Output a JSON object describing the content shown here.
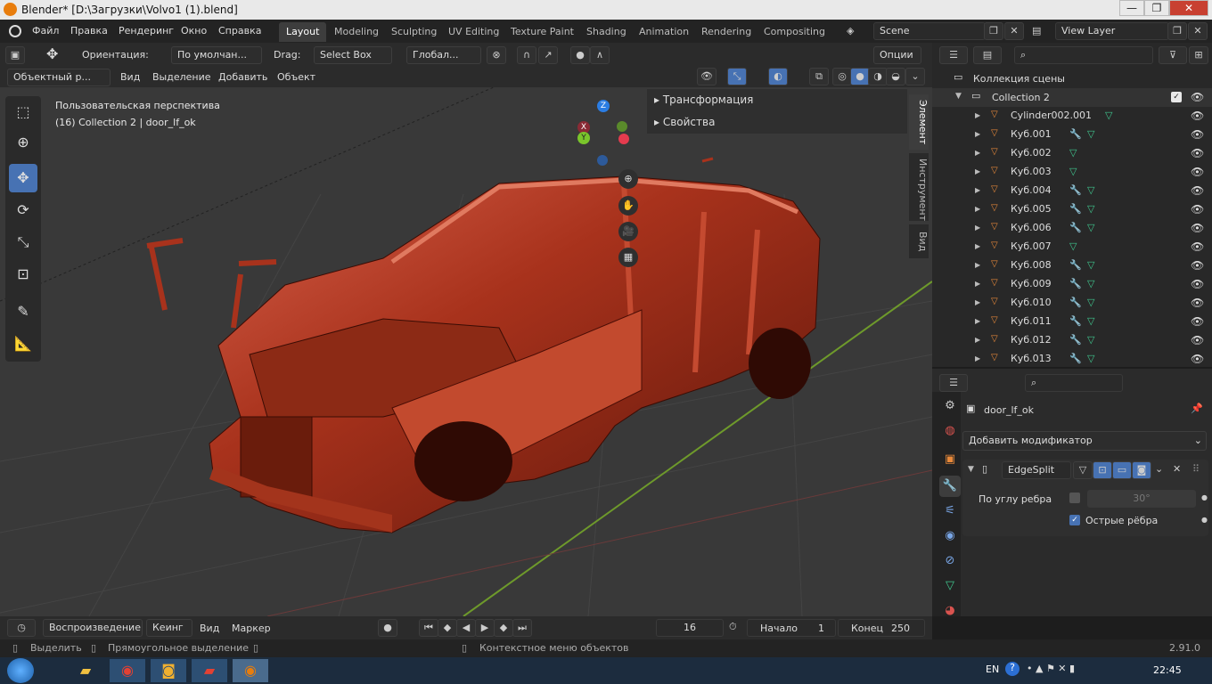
{
  "window": {
    "title": "Blender* [D:\\Загрузки\\Volvo1 (1).blend]",
    "controls": [
      "—",
      "❐",
      "✕"
    ]
  },
  "menu": {
    "items": [
      "Файл",
      "Правка",
      "Рендеринг",
      "Окно",
      "Справка"
    ],
    "workspaces": [
      "Layout",
      "Modeling",
      "Sculpting",
      "UV Editing",
      "Texture Paint",
      "Shading",
      "Animation",
      "Rendering",
      "Compositing"
    ],
    "scene": "Scene",
    "view_layer": "View Layer"
  },
  "header": {
    "orientation_label": "Ориентация:",
    "orientation_value": "По умолчан...",
    "drag_label": "Drag:",
    "drag_value": "Select Box",
    "transform_value": "Глобал...",
    "options": "Опции"
  },
  "header2": {
    "mode": "Объектный р...",
    "items": [
      "Вид",
      "Выделение",
      "Добавить",
      "Объект"
    ]
  },
  "viewport": {
    "perspective": "Пользовательская перспектива",
    "collection_info": "(16) Collection 2 | door_lf_ok",
    "gizmo": {
      "z": "Z",
      "y": "Y",
      "x": "X"
    }
  },
  "npanel": {
    "sections": [
      "Трансформация",
      "Свойства"
    ],
    "tabs": [
      "Элемент",
      "Инструмент",
      "Вид"
    ]
  },
  "outliner": {
    "scene_collection": "Коллекция сцены",
    "collection": "Collection 2",
    "objects": [
      {
        "name": "Cylinder002.001",
        "mod": false
      },
      {
        "name": "Куб.001",
        "mod": true
      },
      {
        "name": "Куб.002",
        "mod": false
      },
      {
        "name": "Куб.003",
        "mod": false
      },
      {
        "name": "Куб.004",
        "mod": true
      },
      {
        "name": "Куб.005",
        "mod": true
      },
      {
        "name": "Куб.006",
        "mod": true
      },
      {
        "name": "Куб.007",
        "mod": false
      },
      {
        "name": "Куб.008",
        "mod": true
      },
      {
        "name": "Куб.009",
        "mod": true
      },
      {
        "name": "Куб.010",
        "mod": true
      },
      {
        "name": "Куб.011",
        "mod": true
      },
      {
        "name": "Куб.012",
        "mod": true
      },
      {
        "name": "Куб.013",
        "mod": true
      }
    ]
  },
  "properties": {
    "object_name": "door_lf_ok",
    "add_modifier": "Добавить модификатор",
    "modifier_name": "EdgeSplit",
    "edge_angle_label": "По углу ребра",
    "edge_angle_value": "30°",
    "sharp_edges_label": "Острые рёбра",
    "sharp_edges_checked": true,
    "edge_angle_checked": false
  },
  "timeline": {
    "items": [
      "Воспроизведение",
      "Кеинг",
      "Вид",
      "Маркер"
    ],
    "current_frame": "16",
    "start_label": "Начало",
    "start": "1",
    "end_label": "Конец",
    "end": "250"
  },
  "status": {
    "select": "Выделить",
    "box_select": "Прямоугольное выделение",
    "context_menu": "Контекстное меню объектов",
    "version": "2.91.0"
  },
  "taskbar": {
    "lang": "EN",
    "time": "22:45"
  },
  "colors": {
    "accent": "#4772b3",
    "car": "#b03a22",
    "grid_green": "#6e9a2b",
    "grid_red": "#8a3030"
  }
}
